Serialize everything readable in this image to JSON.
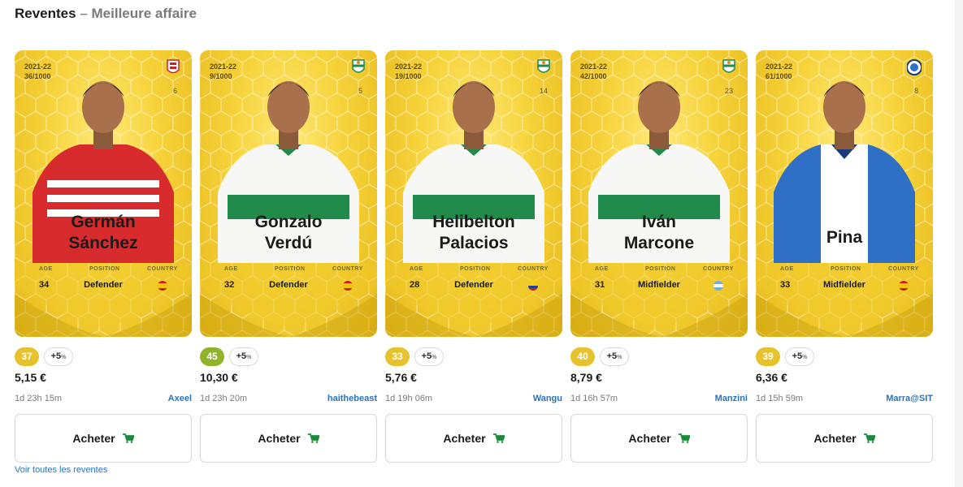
{
  "header": {
    "title": "Reventes",
    "separator": " – ",
    "subtitle": "Meilleure affaire"
  },
  "labels": {
    "age": "AGE",
    "position": "POSITION",
    "country": "COUNTRY",
    "bonus_prefix": "+5",
    "bonus_unit": "%",
    "buy": "Acheter"
  },
  "colors": {
    "score_yellow": "#e6c22d",
    "score_green": "#8fb32b",
    "link": "#2872c4",
    "card_gold": "#f6d33a",
    "cart_green": "#1d8a3a"
  },
  "cards": [
    {
      "season": "2021-22",
      "serial": "36/1000",
      "number": "6",
      "name_line1": "Germán",
      "name_line2": "Sánchez",
      "age": "34",
      "position": "Defender",
      "country_flag": "spain-flag-icon",
      "club": "granada-crest-icon",
      "kit": "red-white-stripes",
      "score": "37",
      "score_color": "yellow",
      "price": "5,15 €",
      "time_left": "1d 23h 15m",
      "seller": "Axeel"
    },
    {
      "season": "2021-22",
      "serial": "9/1000",
      "number": "5",
      "name_line1": "Gonzalo",
      "name_line2": "Verdú",
      "age": "32",
      "position": "Defender",
      "country_flag": "spain-flag-icon",
      "club": "elche-crest-icon",
      "kit": "white-green",
      "score": "45",
      "score_color": "green",
      "price": "10,30 €",
      "time_left": "1d 23h 20m",
      "seller": "haithebeast"
    },
    {
      "season": "2021-22",
      "serial": "19/1000",
      "number": "14",
      "name_line1": "Helibelton",
      "name_line2": "Palacios",
      "age": "28",
      "position": "Defender",
      "country_flag": "colombia-flag-icon",
      "club": "elche-crest-icon",
      "kit": "white-green",
      "score": "33",
      "score_color": "yellow",
      "price": "5,76 €",
      "time_left": "1d 19h 06m",
      "seller": "Wangu"
    },
    {
      "season": "2021-22",
      "serial": "42/1000",
      "number": "23",
      "name_line1": "Iván",
      "name_line2": "Marcone",
      "age": "31",
      "position": "Midfielder",
      "country_flag": "argentina-flag-icon",
      "club": "elche-crest-icon",
      "kit": "white-green",
      "score": "40",
      "score_color": "yellow",
      "price": "8,79 €",
      "time_left": "1d 16h 57m",
      "seller": "Manzini"
    },
    {
      "season": "2021-22",
      "serial": "61/1000",
      "number": "8",
      "name_line1": "Pina",
      "name_line2": "",
      "age": "33",
      "position": "Midfielder",
      "country_flag": "spain-flag-icon",
      "club": "alaves-crest-icon",
      "kit": "blue-white",
      "score": "39",
      "score_color": "yellow",
      "price": "6,36 €",
      "time_left": "1d 15h 59m",
      "seller": "Marra@SIT"
    }
  ],
  "footer": {
    "view_all": "Voir toutes les reventes"
  }
}
